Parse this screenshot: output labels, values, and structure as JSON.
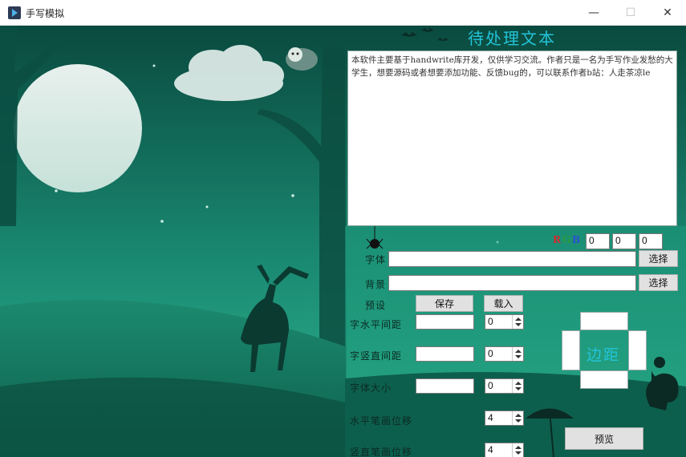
{
  "window": {
    "title": "手写模拟",
    "minimize_symbol": "—",
    "maximize_symbol": "☐",
    "close_symbol": "✕"
  },
  "heading": "待处理文本",
  "text_content": "本软件主要基于handwrite库开发，仅供学习交流。作者只是一名为手写作业发愁的大学生，想要源码或者想要添加功能、反馈bug的，可以联系作者b站：人走茶凉le",
  "rgb": {
    "r_label": "R",
    "g_label": "G",
    "b_label": "B",
    "r_color": "#d2282e",
    "g_color": "#2e9b3a",
    "b_color": "#2a4fd0",
    "r_value": "0",
    "g_value": "0",
    "b_value": "0"
  },
  "font_row": {
    "label": "字体",
    "button": "选择"
  },
  "background_row": {
    "label": "背景",
    "button": "选择"
  },
  "preset_row": {
    "label": "预设",
    "save": "保存",
    "load": "载入"
  },
  "params": {
    "h_spacing": {
      "label": "字水平间距",
      "value": "0"
    },
    "v_spacing": {
      "label": "字竖直间距",
      "value": "0"
    },
    "font_size": {
      "label": "字体大小",
      "value": "0"
    },
    "h_stroke_offset": {
      "label": "水平笔画位移",
      "value": "4"
    },
    "v_stroke_offset": {
      "label": "竖直笔画位移",
      "value": "4"
    }
  },
  "margin_label": "边距",
  "preview_button": "预览",
  "colors": {
    "accent": "#23c4d9",
    "bg_dark": "#0e5a4b"
  },
  "icons": [
    "app-icon",
    "spider-icon",
    "sloth-icon",
    "squirrel-icon",
    "umbrella-icon"
  ]
}
